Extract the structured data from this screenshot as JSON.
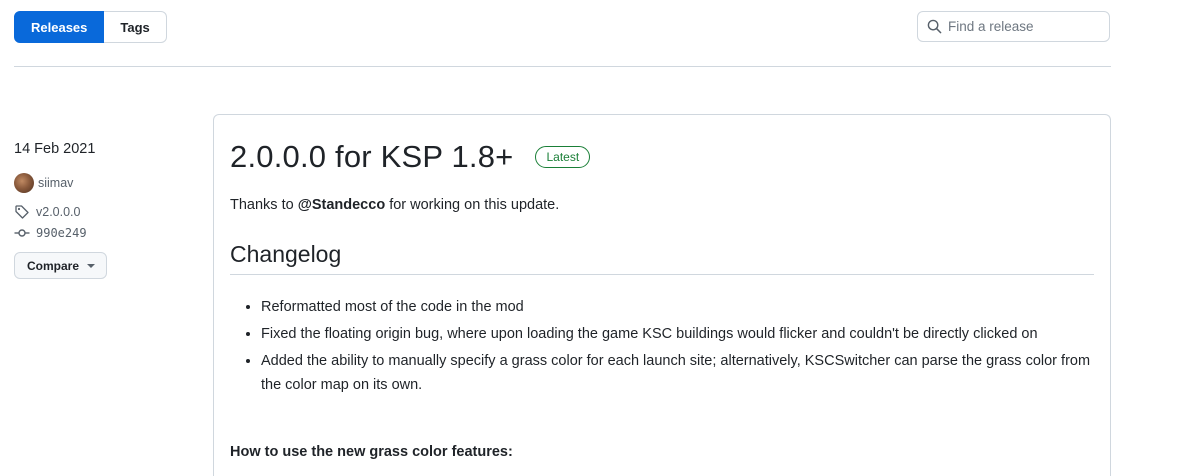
{
  "subnav": {
    "tabs": [
      {
        "label": "Releases",
        "active": true
      },
      {
        "label": "Tags",
        "active": false
      }
    ]
  },
  "search": {
    "placeholder": "Find a release",
    "value": "",
    "icon": "search-icon"
  },
  "release": {
    "date": "14 Feb 2021",
    "author": "siimav",
    "tag": "v2.0.0.0",
    "commit": "990e249",
    "compare_label": "Compare",
    "title": "2.0.0.0 for KSP 1.8+",
    "badge": "Latest",
    "thanks": {
      "prefix": "Thanks to ",
      "mention": "@Standecco",
      "suffix": " for working on this update."
    },
    "changelog_heading": "Changelog",
    "changes": [
      "Reformatted most of the code in the mod",
      "Fixed the floating origin bug, where upon loading the game KSC buildings would flicker and couldn't be directly clicked on",
      "Added the ability to manually specify a grass color for each launch site; alternatively, KSCSwitcher can parse the grass color from the color map on its own."
    ],
    "howto_heading": "How to use the new grass color features:"
  },
  "colors": {
    "accent": "#0969da",
    "latest_badge": "#1a7f37",
    "border": "#d0d7de",
    "muted_text": "#57606a"
  }
}
